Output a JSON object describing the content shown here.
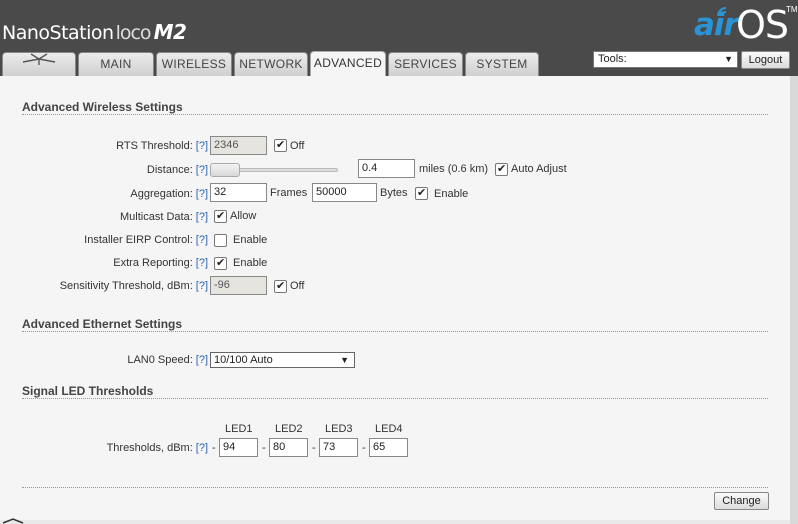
{
  "header": {
    "brand_main": "NanoStation",
    "brand_loco": "loco",
    "brand_model": "M2",
    "logo_air": "air",
    "logo_os": "OS",
    "logo_tm": "TM"
  },
  "tabs": [
    "MAIN",
    "WIRELESS",
    "NETWORK",
    "ADVANCED",
    "SERVICES",
    "SYSTEM"
  ],
  "active_tab": "ADVANCED",
  "tools": {
    "selected": "Tools:",
    "logout_label": "Logout"
  },
  "help_label": "[?]",
  "wireless": {
    "title": "Advanced Wireless Settings",
    "rts_label": "RTS Threshold:",
    "rts_value": "2346",
    "rts_off_label": "Off",
    "rts_off_checked": true,
    "distance_label": "Distance:",
    "distance_value": "0.4",
    "distance_unit": "miles (0.6 km)",
    "distance_slider_level": 0.0,
    "auto_adjust_label": "Auto Adjust",
    "auto_adjust_checked": true,
    "aggregation_label": "Aggregation:",
    "aggregation_frames": "32",
    "frames_label": "Frames",
    "aggregation_bytes": "50000",
    "bytes_label": "Bytes",
    "aggregation_enable_label": "Enable",
    "aggregation_enable_checked": true,
    "multicast_label": "Multicast Data:",
    "multicast_allow_label": "Allow",
    "multicast_checked": true,
    "eirp_label": "Installer EIRP Control:",
    "eirp_enable_label": "Enable",
    "eirp_checked": false,
    "extra_label": "Extra Reporting:",
    "extra_enable_label": "Enable",
    "extra_checked": true,
    "sensitivity_label": "Sensitivity Threshold, dBm:",
    "sensitivity_value": "-96",
    "sensitivity_off_label": "Off",
    "sensitivity_off_checked": true
  },
  "ethernet": {
    "title": "Advanced Ethernet Settings",
    "lan0_label": "LAN0 Speed:",
    "lan0_value": "10/100 Auto"
  },
  "led": {
    "title": "Signal LED Thresholds",
    "thresholds_label": "Thresholds, dBm:",
    "minus": "-",
    "leds": [
      {
        "label": "LED1",
        "value": "94"
      },
      {
        "label": "LED2",
        "value": "80"
      },
      {
        "label": "LED3",
        "value": "73"
      },
      {
        "label": "LED4",
        "value": "65"
      }
    ]
  },
  "change_label": "Change",
  "colors": {
    "header_bg": "#4a4a4a",
    "accent_blue": "#2a93d6",
    "help_link": "#2c64b0"
  }
}
